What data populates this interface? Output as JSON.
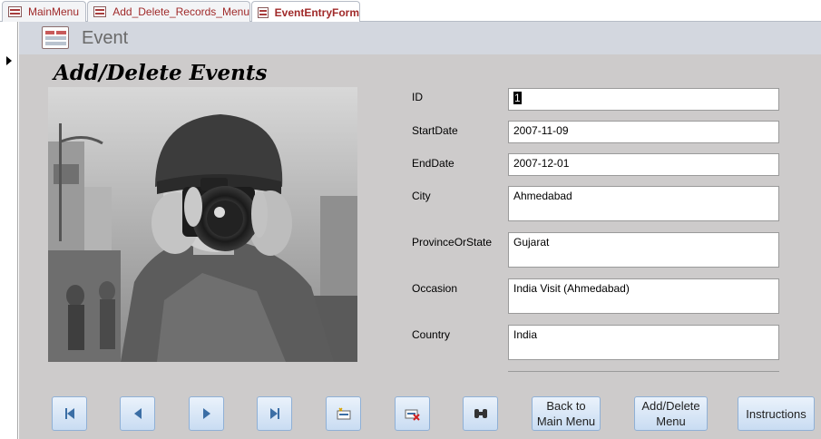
{
  "tabs": [
    {
      "label": "MainMenu",
      "active": false
    },
    {
      "label": "Add_Delete_Records_Menu",
      "active": false
    },
    {
      "label": "EventEntryForm",
      "active": true
    }
  ],
  "header": {
    "title": "Event"
  },
  "form": {
    "title": "Add/Delete Events",
    "fields": {
      "id": {
        "label": "ID",
        "value": "1"
      },
      "startdate": {
        "label": "StartDate",
        "value": "2007-11-09"
      },
      "enddate": {
        "label": "EndDate",
        "value": "2007-12-01"
      },
      "city": {
        "label": "City",
        "value": "Ahmedabad"
      },
      "province": {
        "label": "ProvinceOrState",
        "value": "Gujarat"
      },
      "occasion": {
        "label": "Occasion",
        "value": "India Visit (Ahmedabad)"
      },
      "country": {
        "label": "Country",
        "value": "India"
      }
    }
  },
  "buttons": {
    "first_icon": "first-record-icon",
    "prev_icon": "previous-record-icon",
    "next_icon": "next-record-icon",
    "last_icon": "last-record-icon",
    "new_icon": "new-record-icon",
    "delete_icon": "delete-record-icon",
    "find_icon": "binoculars-icon",
    "back_line1": "Back to",
    "back_line2": "Main Menu",
    "adddel_line1": "Add/Delete",
    "adddel_line2": "Menu",
    "instructions": "Instructions"
  },
  "colors": {
    "detail_bg": "#cdcbcb",
    "header_bg": "#d3d7df",
    "tab_text": "#a02a2a",
    "button_blue": "#3b6ea5"
  }
}
